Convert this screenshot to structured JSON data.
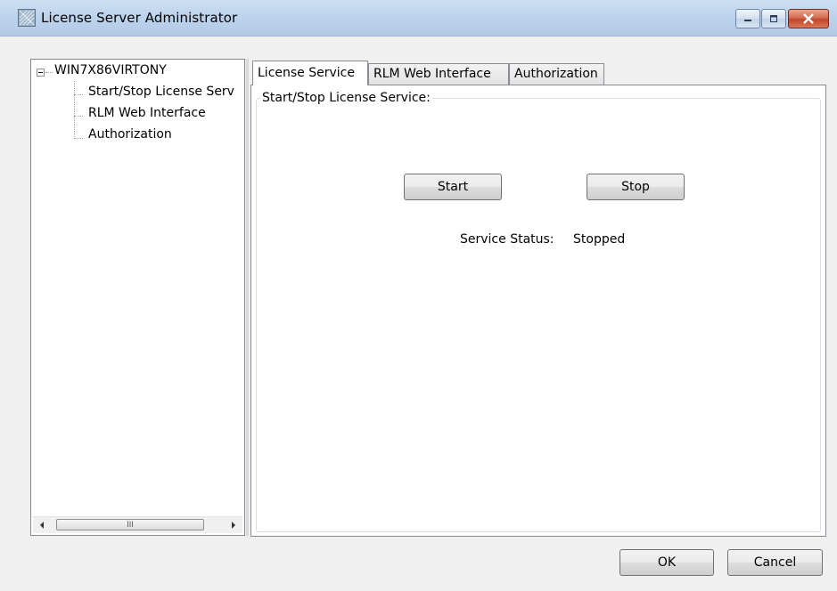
{
  "window": {
    "title": "License Server Administrator",
    "icon": "license-server-app-icon",
    "controls": [
      "minimize-icon",
      "maximize-icon",
      "close-icon"
    ]
  },
  "tree": {
    "root": "WIN7X86VIRTONY",
    "expanded": true,
    "items": [
      {
        "label": "Start/Stop License Serv"
      },
      {
        "label": "RLM Web Interface"
      },
      {
        "label": "Authorization"
      }
    ],
    "scroll_thumb_glyph": "III"
  },
  "tabs": [
    {
      "label": "License Service",
      "active": true
    },
    {
      "label": "RLM Web Interface",
      "active": false
    },
    {
      "label": "Authorization",
      "active": false
    }
  ],
  "panel": {
    "group_title": "Start/Stop License Service:",
    "start_label": "Start",
    "stop_label": "Stop",
    "status_label": "Service Status:",
    "status_value": "Stopped"
  },
  "footer": {
    "ok_label": "OK",
    "cancel_label": "Cancel"
  }
}
